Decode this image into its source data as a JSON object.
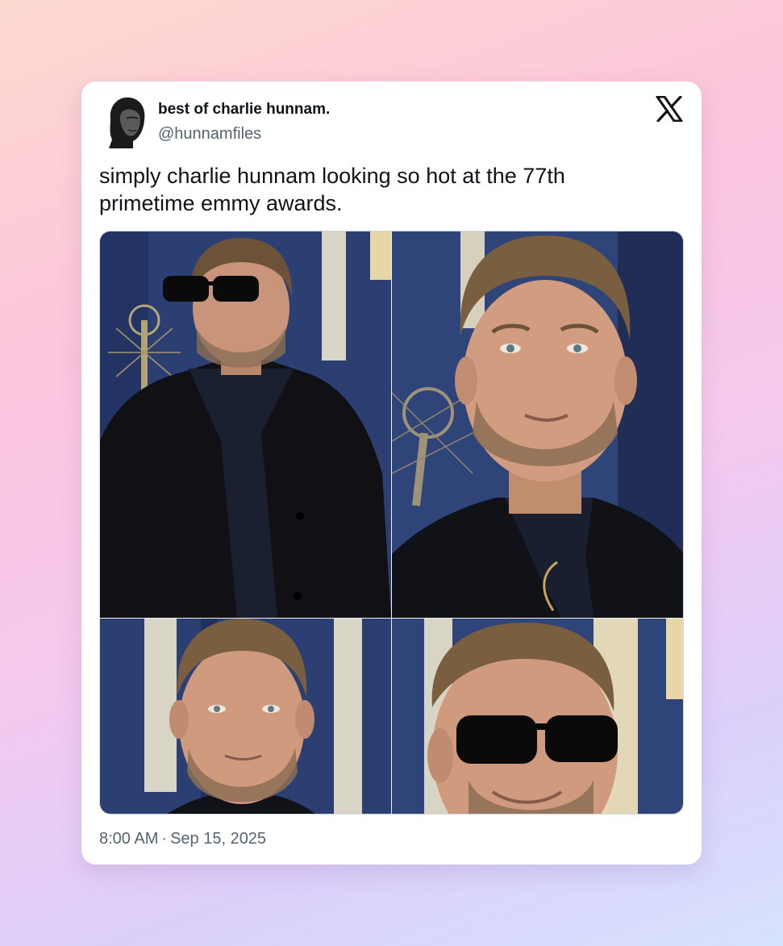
{
  "tweet": {
    "display_name": "best of charlie hunnam.",
    "handle": "@hunnamfiles",
    "text": "simply charlie hunnam looking so hot at the 77th primetime emmy awards.",
    "time": "8:00 AM",
    "separator": "·",
    "date": "Sep 15, 2025",
    "platform_icon": "x-logo-icon",
    "media": [
      {
        "name": "photo-1",
        "alt_icon": "photo-sunglasses-full-suit"
      },
      {
        "name": "photo-2",
        "alt_icon": "photo-close-up-smiling"
      },
      {
        "name": "photo-3",
        "alt_icon": "photo-close-up-portrait"
      },
      {
        "name": "photo-4",
        "alt_icon": "photo-sunglasses-close-up"
      }
    ]
  },
  "colors": {
    "text_primary": "#0f1419",
    "text_secondary": "#536471",
    "card_background": "#ffffff",
    "backdrop_blue": "#2b3f73",
    "backdrop_gold": "#e8d7a6"
  }
}
